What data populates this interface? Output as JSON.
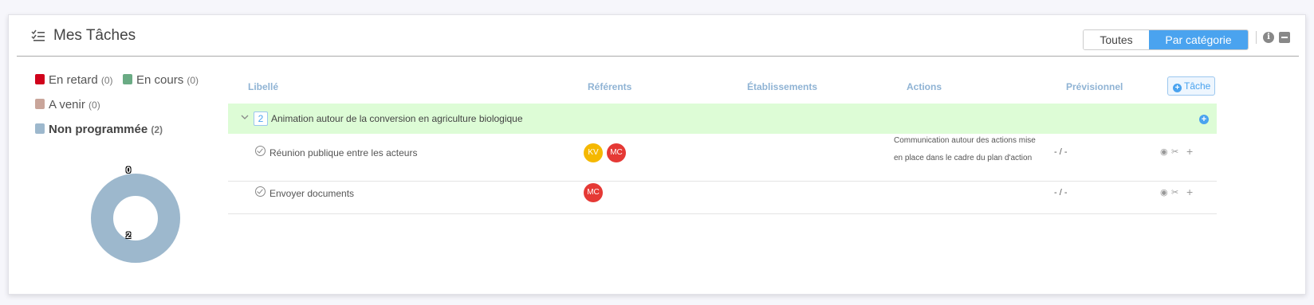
{
  "header": {
    "title": "Mes Tâches",
    "view_toggle": [
      "Toutes",
      "Par catégorie"
    ],
    "active_view": "Par catégorie",
    "info_icon_glyph": "i"
  },
  "legend": [
    {
      "label": "En retard",
      "count": "(0)",
      "color": "#d0021b"
    },
    {
      "label": "En cours",
      "count": "(0)",
      "color": "#6aab84"
    },
    {
      "label": "A venir",
      "count": "(0)",
      "color": "#c9a59a"
    },
    {
      "label": "Non programmée",
      "count": "(2)",
      "color": "#9db8cd"
    }
  ],
  "donut": {
    "labels": [
      "0",
      "2"
    ],
    "color": "#9db8cd"
  },
  "table": {
    "columns": [
      "Libellé",
      "Référents",
      "Établissements",
      "Actions",
      "Prévisionnel"
    ],
    "add_task_label": "Tâche",
    "group": {
      "count": "2",
      "label": "Animation autour de la conversion en agriculture biologique"
    },
    "rows": [
      {
        "label": "Réunion publique entre les acteurs",
        "referents": [
          {
            "initials": "KV",
            "color": "#f5b800"
          },
          {
            "initials": "MC",
            "color": "#e53935"
          }
        ],
        "action": "Communication autour des actions mise en place dans le cadre du plan d'action",
        "previsionnel": "- / -"
      },
      {
        "label": "Envoyer documents",
        "referents": [
          {
            "initials": "MC",
            "color": "#e53935"
          }
        ],
        "action": "",
        "previsionnel": "- / -"
      }
    ]
  }
}
